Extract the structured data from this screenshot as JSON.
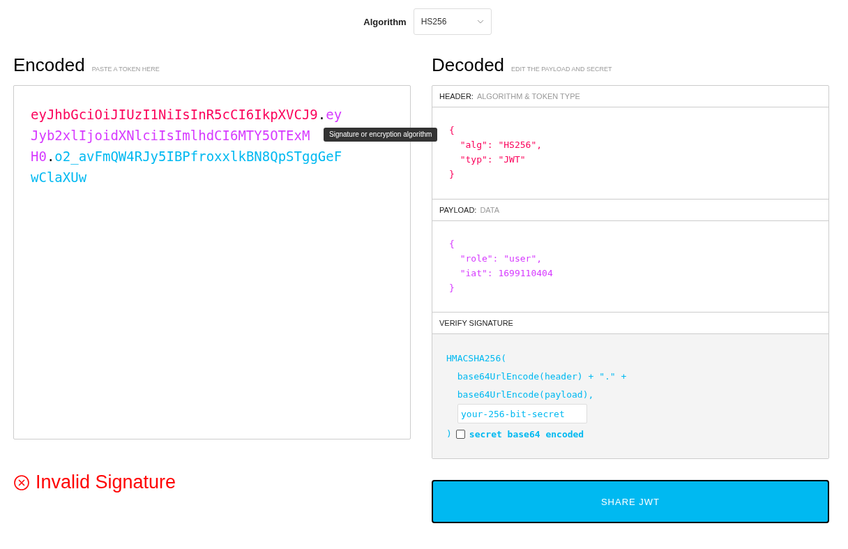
{
  "algorithm": {
    "label": "Algorithm",
    "value": "HS256"
  },
  "encoded": {
    "title": "Encoded",
    "hint": "PASTE A TOKEN HERE",
    "lines": [
      [
        {
          "kind": "header",
          "text": "eyJhbGciOiJIUzI1NiIsInR5cCI6IkpXVCJ9"
        },
        {
          "kind": "dot",
          "text": "."
        },
        {
          "kind": "payload",
          "text": "ey"
        }
      ],
      [
        {
          "kind": "payload",
          "text": "Jyb2xlIjoidXNlciIsImlhdCI6MTY5OTExM"
        }
      ],
      [
        {
          "kind": "payload",
          "text": "H0"
        },
        {
          "kind": "dot",
          "text": "."
        },
        {
          "kind": "signature",
          "text": "o2_avFmQW4RJy5IBPfroxxlkBN8QpSTggGeF"
        }
      ],
      [
        {
          "kind": "signature",
          "text": "wClaXUw"
        }
      ]
    ],
    "tooltip": "Signature or encryption algorithm"
  },
  "decoded": {
    "title": "Decoded",
    "hint": "EDIT THE PAYLOAD AND SECRET",
    "sections": [
      {
        "kind": "header",
        "label": "HEADER:",
        "sublabel": "ALGORITHM & TOKEN TYPE",
        "lines": [
          "{",
          "  \"alg\": \"HS256\",",
          "  \"typ\": \"JWT\"",
          "}"
        ]
      },
      {
        "kind": "payload",
        "label": "PAYLOAD:",
        "sublabel": "DATA",
        "lines": [
          "{",
          "  \"role\": \"user\",",
          "  \"iat\": 1699110404",
          "}"
        ]
      },
      {
        "kind": "verify",
        "label": "VERIFY SIGNATURE",
        "lines": [
          "HMACSHA256(",
          "  base64UrlEncode(header) + \".\" +",
          "  base64UrlEncode(payload),"
        ],
        "secret_placeholder": "your-256-bit-secret",
        "close": ")",
        "checkbox": {
          "label": "secret base64 encoded",
          "checked": false
        }
      }
    ]
  },
  "status": {
    "valid": false,
    "text": "Invalid Signature"
  },
  "share_button": "SHARE JWT"
}
